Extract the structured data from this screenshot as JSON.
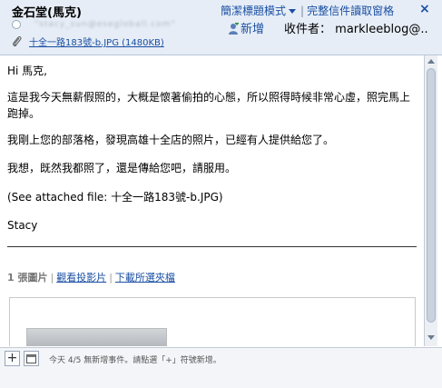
{
  "header": {
    "sender": "金石堂(馬克)",
    "view_mode": "簡潔標題模式",
    "full_read_pane": "完整信件讀取窗格",
    "separator": "|",
    "close": "×",
    "sender_email_blurred": "\"stacy_sun@esegloball.com\"",
    "add_button": "新增",
    "recipient_label": "收件者：",
    "recipient_value": "markleeblog@..",
    "attachment": "十全一路183號-b.JPG (1480KB)"
  },
  "body": {
    "greeting": "Hi 馬克,",
    "para1": "這是我今天無薪假照的，大概是懷著偷拍的心態，所以照得時候非常心虛，照完馬上跑掉。",
    "para2": "我剛上您的部落格，發現高雄十全店的照片，已經有人提供給您了。",
    "para3": "我想，既然我都照了，還是傳給您吧，請服用。",
    "para4": "(See attached file: 十全一路183號-b.JPG)",
    "signature": "Stacy"
  },
  "photos": {
    "count_label": "1 張圖片",
    "slideshow_link": "觀看投影片",
    "download_link": "下載所選夾檔",
    "bar": "|"
  },
  "footer": {
    "add_symbol": "+",
    "status": "今天 4/5  無新增事件。請點選「+」符號新增。"
  },
  "icons": [
    "radio-icon",
    "person-add-icon",
    "paperclip-icon",
    "calendar-icon",
    "plus-icon"
  ],
  "colors": {
    "link": "#1a4fa3",
    "header_bg": "#e6edf6"
  }
}
